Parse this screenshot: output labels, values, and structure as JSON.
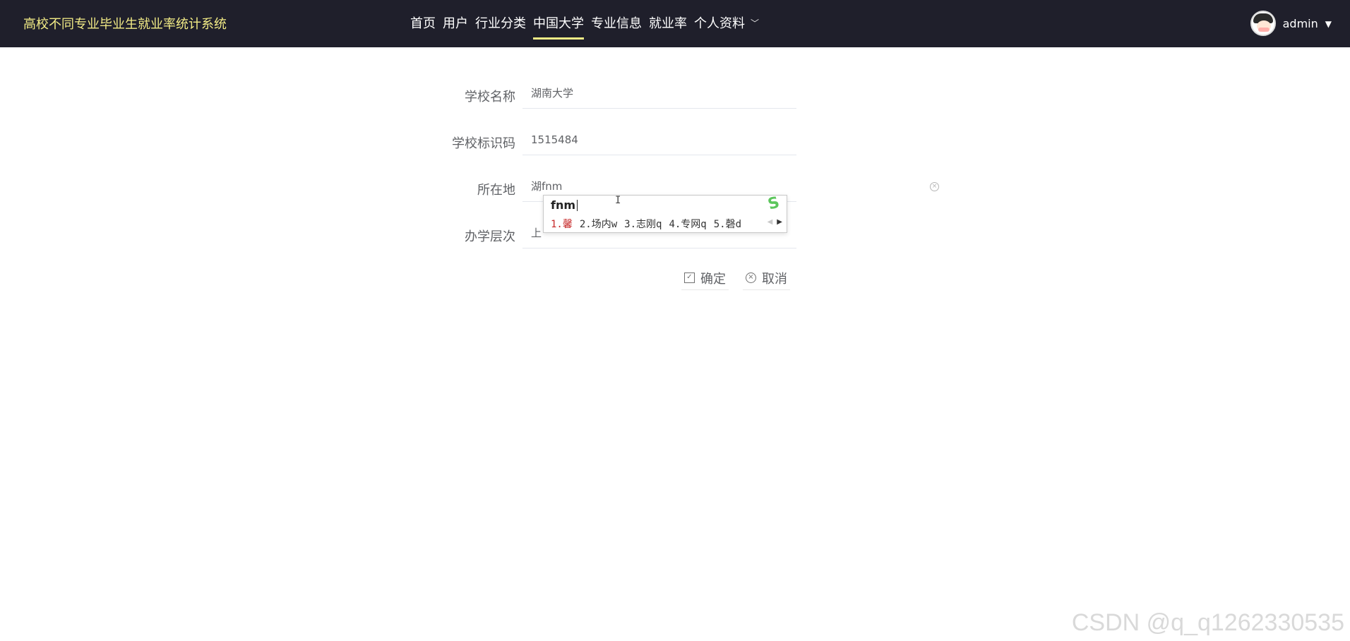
{
  "app": {
    "title": "高校不同专业毕业生就业率统计系统"
  },
  "nav": {
    "items": [
      {
        "label": "首页"
      },
      {
        "label": "用户"
      },
      {
        "label": "行业分类"
      },
      {
        "label": "中国大学"
      },
      {
        "label": "专业信息"
      },
      {
        "label": "就业率"
      },
      {
        "label": "个人资料"
      }
    ],
    "active": "中国大学",
    "dropdown_icon": "chevron-down-icon"
  },
  "user": {
    "name": "admin",
    "avatar_icon": "avatar-icon",
    "caret_icon": "caret-down-icon"
  },
  "form": {
    "fields": [
      {
        "label": "学校名称",
        "value": "湖南大学"
      },
      {
        "label": "学校标识码",
        "value": "1515484"
      },
      {
        "label": "所在地",
        "value": "湖fnm"
      },
      {
        "label": "办学层次",
        "value": "上"
      }
    ],
    "clear_icon": "clear-icon"
  },
  "actions": {
    "confirm_label": "确定",
    "cancel_label": "取消",
    "confirm_icon": "checkbox-icon",
    "cancel_icon": "circle-x-icon"
  },
  "ime": {
    "input": "fnm",
    "logo_icon": "sogou-s-icon",
    "candidates": [
      "1.馨",
      "2.场内w",
      "3.志刚q",
      "4.专网q",
      "5.磬d"
    ],
    "prev_icon": "triangle-left-icon",
    "next_icon": "triangle-right-icon"
  },
  "watermark": "CSDN @q_q1262330535",
  "colors": {
    "topbar": "#1f1f2b",
    "brand": "#f3ec86",
    "text": "#606266"
  }
}
